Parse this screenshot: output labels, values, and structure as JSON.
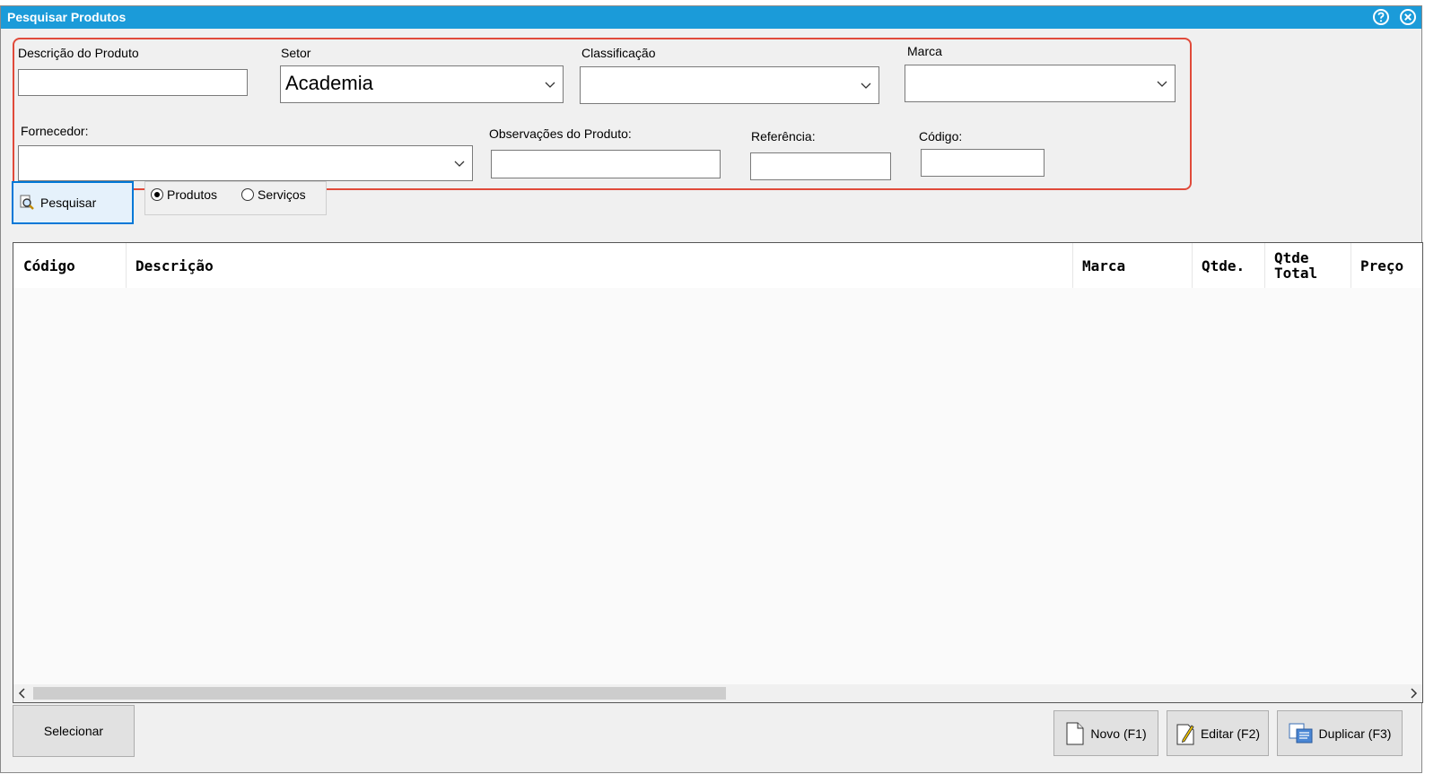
{
  "window": {
    "title": "Pesquisar Produtos"
  },
  "filters": {
    "descricao_label": "Descrição do Produto",
    "descricao_value": "",
    "setor_label": "Setor",
    "setor_value": "Academia",
    "classificacao_label": "Classificação",
    "classificacao_value": "",
    "marca_label": "Marca",
    "marca_value": "",
    "fornecedor_label": "Fornecedor:",
    "fornecedor_value": "",
    "observacoes_label": "Observações do Produto:",
    "observacoes_value": "",
    "referencia_label": "Referência:",
    "referencia_value": "",
    "codigo_label": "Código:",
    "codigo_value": ""
  },
  "search": {
    "button_label": "Pesquisar",
    "radio_produtos": "Produtos",
    "radio_servicos": "Serviços",
    "selected": "Produtos"
  },
  "grid": {
    "columns": [
      "Código",
      "Descrição",
      "Marca",
      "Qtde.",
      "Qtde Total",
      "Preço"
    ],
    "rows": []
  },
  "footer": {
    "selecionar": "Selecionar",
    "novo": "Novo (F1)",
    "editar": "Editar (F2)",
    "duplicar": "Duplicar (F3)"
  },
  "icons": {
    "help": "help-circle-icon",
    "close": "close-circle-icon",
    "search": "magnifier-icon",
    "new": "document-icon",
    "edit": "edit-document-icon",
    "duplicate": "duplicate-icon"
  },
  "colors": {
    "titlebar": "#1b9bd9",
    "highlight_border": "#e04a3a",
    "focus_border": "#0078d7"
  }
}
